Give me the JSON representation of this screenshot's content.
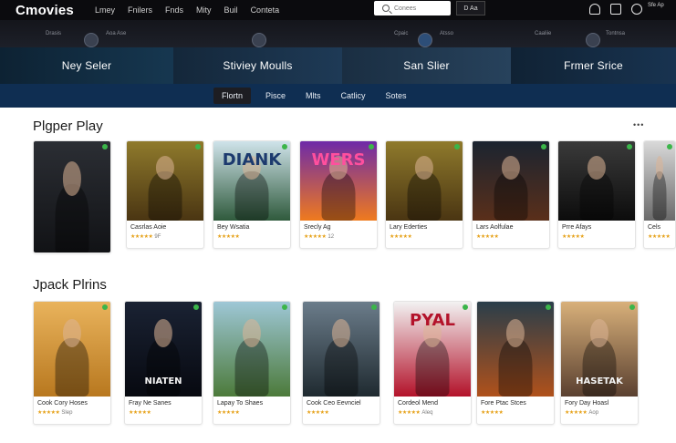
{
  "header": {
    "logo": "Cmovies",
    "nav_links": [
      "Lmey",
      "Fnilers",
      "Fnds",
      "Mity",
      "Buil",
      "Conteta"
    ],
    "search": {
      "placeholder": "Conees",
      "button": "D Aa"
    },
    "account_text": "Sfe Ap",
    "icons": [
      "bell-icon",
      "cart-icon",
      "account-icon"
    ]
  },
  "substrip": {
    "items": [
      "Drasis",
      "Aoa Ase",
      "Cpaic",
      "Atsso",
      "Caaliie",
      "Tontnsa"
    ]
  },
  "banner": {
    "items": [
      "Ney Seler",
      "Stiviey Moulls",
      "San Slier",
      "Frmer Srice"
    ]
  },
  "tabs": {
    "items": [
      "Flortn",
      "Pisce",
      "Mlts",
      "Catlicy",
      "Sotes"
    ],
    "active_index": 0
  },
  "sections": [
    {
      "title": "Plgper Play",
      "more": "•••",
      "cards": [
        {
          "title": "",
          "rating_text": "",
          "poster_text": "",
          "poster_top": "#2b2e34",
          "poster_bottom": "#111215"
        },
        {
          "title": "Casrlas Aoie",
          "rating_text": "9F",
          "poster_text": "",
          "poster_top": "#8f7a2c",
          "poster_bottom": "#4a3512"
        },
        {
          "title": "Bey Wsatia",
          "rating_text": "",
          "poster_text": "DIANK",
          "poster_top": "#cfe3ea",
          "poster_bottom": "#2f5a3c"
        },
        {
          "title": "Srecly Ag",
          "rating_text": "12",
          "poster_text": "WERS",
          "poster_top": "#6e2aa8",
          "poster_bottom": "#ef7a1e"
        },
        {
          "title": "Lary Ederties",
          "rating_text": "",
          "poster_text": "",
          "poster_top": "#8f7a2c",
          "poster_bottom": "#4a3512"
        },
        {
          "title": "Lars Aolfulae",
          "rating_text": "",
          "poster_text": "",
          "poster_top": "#1b2430",
          "poster_bottom": "#5a2f1a"
        },
        {
          "title": "Prre Afays",
          "rating_text": "",
          "poster_text": "",
          "poster_top": "#3a3a3a",
          "poster_bottom": "#0c0c0c"
        },
        {
          "title": "Cels",
          "rating_text": "",
          "poster_text": "",
          "poster_top": "#d9d9d9",
          "poster_bottom": "#6a6a6a"
        }
      ]
    },
    {
      "title": "Jpack Plrins",
      "cards": [
        {
          "title": "Cook Cory Hoses",
          "rating_text": "Slep",
          "poster_text": "",
          "poster_top": "#e9b35c",
          "poster_bottom": "#b8781f"
        },
        {
          "title": "Fray Ne Sanes",
          "rating_text": "",
          "poster_text": "NIATEN",
          "poster_top": "#1a2233",
          "poster_bottom": "#070910"
        },
        {
          "title": "Lapay To Shaes",
          "rating_text": "",
          "poster_text": "",
          "poster_top": "#9ec7d6",
          "poster_bottom": "#4c7a3a"
        },
        {
          "title": "Cook Ceo Eevnciel",
          "rating_text": "",
          "poster_text": "",
          "poster_top": "#6b7c8a",
          "poster_bottom": "#1f2a30"
        },
        {
          "title": "Cordeol Mend",
          "rating_text": "Aleq",
          "poster_text": "PYAL",
          "poster_top": "#f2f2f2",
          "poster_bottom": "#b3122a"
        },
        {
          "title": "Fore Ptac Stces",
          "rating_text": "",
          "poster_text": "",
          "poster_top": "#2a3e4a",
          "poster_bottom": "#b0511b"
        },
        {
          "title": "Fory Day Hoasl",
          "rating_text": "Aop",
          "poster_text": "HASETAK",
          "poster_top": "#d8b07a",
          "poster_bottom": "#5a4030"
        }
      ]
    }
  ]
}
